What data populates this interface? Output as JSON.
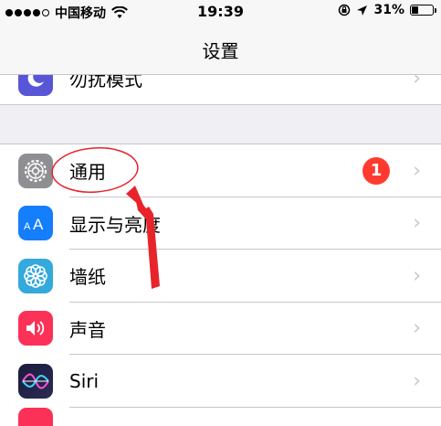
{
  "status": {
    "carrier": "中国移动",
    "time": "19:39",
    "battery": "31%",
    "battery_level": 0.31,
    "signal_bars": 4
  },
  "nav": {
    "title": "设置"
  },
  "top_row": {
    "label": "勿扰模式",
    "icon": "moon-icon",
    "color": "#5856d6"
  },
  "rows": [
    {
      "label": "通用",
      "icon": "gear-icon",
      "color": "#8e8e93",
      "badge": "1"
    },
    {
      "label": "显示与亮度",
      "icon": "aa-text-icon",
      "color": "#147efb"
    },
    {
      "label": "墙纸",
      "icon": "flower-icon",
      "color": "#33a9dc"
    },
    {
      "label": "声音",
      "icon": "speaker-icon",
      "color": "#fc3158"
    },
    {
      "label": "Siri",
      "icon": "siri-icon",
      "color": "#222244"
    }
  ],
  "colors": {
    "badge": "#ff3b30",
    "annotation": "#e8242b"
  }
}
